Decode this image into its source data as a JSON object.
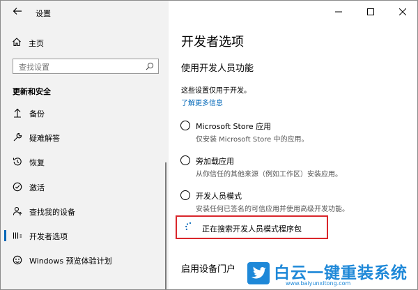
{
  "window": {
    "title": "设置",
    "controls": [
      "minimize-icon",
      "maximize-icon",
      "close-icon"
    ]
  },
  "sidebar": {
    "home_label": "主页",
    "search_placeholder": "查找设置",
    "section_title": "更新和安全",
    "items": [
      {
        "label": "备份",
        "icon": "upload-arrow-icon"
      },
      {
        "label": "疑难解答",
        "icon": "wrench-icon"
      },
      {
        "label": "恢复",
        "icon": "history-icon"
      },
      {
        "label": "激活",
        "icon": "check-circle-icon"
      },
      {
        "label": "查找我的设备",
        "icon": "person-pin-icon"
      },
      {
        "label": "开发者选项",
        "icon": "developer-icon",
        "active": true
      },
      {
        "label": "Windows 预览体验计划",
        "icon": "insider-icon"
      }
    ]
  },
  "main": {
    "page_title": "开发者选项",
    "subtitle": "使用开发人员功能",
    "description": "这些设置仅用于开发。",
    "learn_more": "了解更多信息",
    "options": [
      {
        "label": "Microsoft Store 应用",
        "sub": "仅安装 Microsoft Store 中的应用。"
      },
      {
        "label": "旁加载应用",
        "sub": "从你信任的其他来源（例如工作区）安装应用。"
      },
      {
        "label": "开发人员模式",
        "sub": "安装任何已签名的可信应用并使用高级开发功能。"
      }
    ],
    "status": "正在搜索开发人员模式程序包",
    "bottom_heading": "启用设备门户"
  },
  "watermark": {
    "brand": "白云一键重装系统",
    "url": "www.baiyunxitong.com"
  },
  "colors": {
    "accent": "#0067b8",
    "highlight_border": "#d9262b",
    "sidebar_bg": "#f2f2f2",
    "watermark_blue": "#1e88d8"
  }
}
